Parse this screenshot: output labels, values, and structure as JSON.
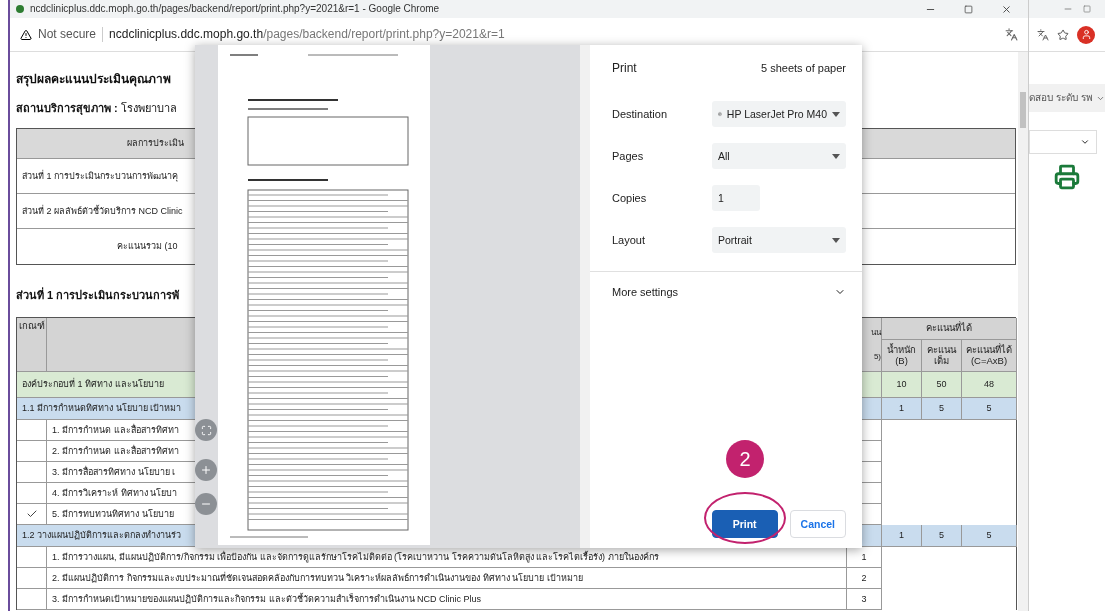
{
  "browser": {
    "title": "ncdclinicplus.ddc.moph.go.th/pages/backend/report/print.php?y=2021&r=1 - Google Chrome",
    "security": "Not secure",
    "url_host": "ncdclinicplus.ddc.moph.go.th",
    "url_path": "/pages/backend/report/print.php?y=2021&r=1"
  },
  "report": {
    "heading": "สรุปผลคะแนนประเมินคุณภาพ",
    "facility_label": "สถานบริการสุขภาพ :",
    "facility_value": "โรงพยาบาล",
    "summary": {
      "header": "ผลการประเมิน",
      "rows": [
        {
          "kind": "part",
          "text": "ส่วนที่ 1 การประเมินกระบวนการพัฒนาคุ"
        },
        {
          "kind": "part",
          "text": "ส่วนที่ 2 ผลลัพธ์ตัวชี้วัดบริการ NCD Clinic"
        },
        {
          "kind": "total",
          "text": "คะแนนรวม (10"
        }
      ]
    },
    "section_heading": "ส่วนที่ 1 การประเมินกระบวนการพั",
    "table": {
      "columns": {
        "criterion": "เกณฑ์",
        "score_top": "นน",
        "score_bottom": "5)",
        "earned": "คะแนนที่ได้",
        "weight": "น้ำหนัก (B)",
        "full": "คะแนนเต็ม",
        "result": "คะแนนที่ได้ (C=AxB)"
      },
      "rows": [
        {
          "kind": "component",
          "text": "องค์ประกอบที่ 1 ทิศทาง และนโยบาย",
          "weight": "10",
          "full": "50",
          "result": "48"
        },
        {
          "kind": "group",
          "text": "1.1 มีการกำหนดทิศทาง นโยบาย เป้าหมา",
          "weight": "1",
          "full": "5",
          "result": "5"
        },
        {
          "kind": "item",
          "checked": false,
          "text": "1. มีการกำหนด และสื่อสารทิศทา"
        },
        {
          "kind": "item",
          "checked": false,
          "text": "2. มีการกำหนด และสื่อสารทิศทา"
        },
        {
          "kind": "item",
          "checked": false,
          "text": "3. มีการสื่อสารทิศทาง นโยบาย เ"
        },
        {
          "kind": "item",
          "checked": false,
          "text": "4. มีการวิเคราะห์ ทิศทาง นโยบา"
        },
        {
          "kind": "item",
          "checked": true,
          "text": "5. มีการทบทวนทิศทาง นโยบาย"
        },
        {
          "kind": "group",
          "text": "1.2 วางแผนปฏิบัติการและตกลงทำงานร่ว",
          "weight": "1",
          "full": "5",
          "result": "5"
        },
        {
          "kind": "item",
          "checked": false,
          "text": "1. มีการวางแผน, มีแผนปฏิบัติการ/กิจกรรม เพื่อป้องกัน และจัดการดูแลรักษาโรคไม่ติดต่อ (โรคเบาหวาน โรคความดันโลหิตสูง และโรคไตเรื้อรัง) ภายในองค์กร",
          "score": "1"
        },
        {
          "kind": "item",
          "checked": false,
          "text": "2. มีแผนปฏิบัติการ กิจกรรมและงบประมาณที่ชัดเจนสอดคล้องกับการทบทวน วิเคราะห์ผลลัพธ์การดำเนินงานของ ทิศทาง นโยบาย เป้าหมาย",
          "score": "2"
        },
        {
          "kind": "item",
          "checked": false,
          "text": "3. มีการกำหนดเป้าหมายของแผนปฏิบัติการและกิจกรรม และตัวชี้วัดความสำเร็จการดำเนินงาน NCD Clinic Plus",
          "score": "3"
        }
      ]
    }
  },
  "print_dialog": {
    "title": "Print",
    "sheets": "5 sheets of paper",
    "settings": [
      {
        "kind": "destination",
        "label": "Destination",
        "value": "HP LaserJet Pro M40"
      },
      {
        "kind": "select",
        "label": "Pages",
        "value": "All"
      },
      {
        "kind": "number",
        "label": "Copies",
        "value": "1"
      },
      {
        "kind": "select",
        "label": "Layout",
        "value": "Portrait"
      }
    ],
    "more_settings": {
      "label": "More settings",
      "expanded": false
    },
    "buttons": [
      {
        "kind": "primary",
        "label": "Print"
      },
      {
        "kind": "secondary",
        "label": "Cancel"
      }
    ],
    "step_badge": "2"
  },
  "side_window": {
    "menu": "ดสอบ ระดับ รพ"
  }
}
